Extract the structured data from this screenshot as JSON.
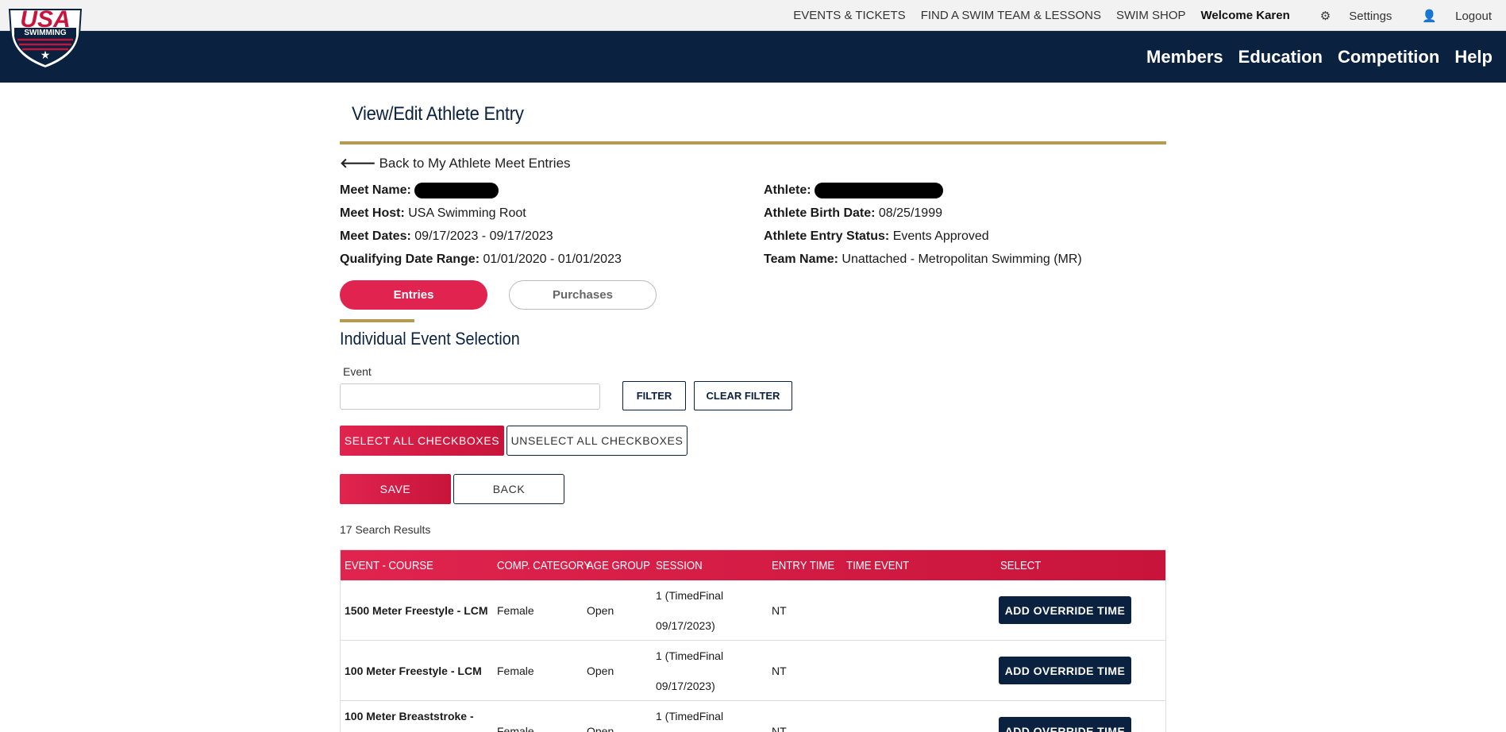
{
  "topbar": {
    "events_tickets": "EVENTS & TICKETS",
    "find_swim_team": "FIND A SWIM TEAM & LESSONS",
    "swim_shop": "SWIM SHOP",
    "welcome": "Welcome Karen",
    "settings": "Settings",
    "logout": "Logout"
  },
  "logo": {
    "line1": "USA",
    "line2": "SWIMMING"
  },
  "mainnav": {
    "members": "Members",
    "education": "Education",
    "competition": "Competition",
    "help": "Help"
  },
  "page": {
    "title": "View/Edit Athlete Entry",
    "back_link": "Back to My Athlete Meet Entries"
  },
  "meet_info": {
    "meet_name_label": "Meet Name:",
    "meet_host_label": "Meet Host:",
    "meet_host": "USA Swimming Root",
    "meet_dates_label": "Meet Dates:",
    "meet_dates": "09/17/2023 - 09/17/2023",
    "qualifying_label": "Qualifying Date Range:",
    "qualifying_range": "01/01/2020 - 01/01/2023"
  },
  "athlete_info": {
    "athlete_label": "Athlete:",
    "birth_label": "Athlete Birth Date:",
    "birth_date": "08/25/1999",
    "status_label": "Athlete Entry Status:",
    "status": "Events Approved",
    "team_label": "Team Name:",
    "team": "Unattached - Metropolitan Swimming (MR)"
  },
  "tabs": {
    "entries": "Entries",
    "purchases": "Purchases"
  },
  "section": {
    "title": "Individual Event Selection",
    "event_label": "Event",
    "event_value": "",
    "filter": "FILTER",
    "clear_filter": "CLEAR FILTER",
    "select_all": "SELECT ALL CHECKBOXES",
    "unselect_all": "UNSELECT ALL CHECKBOXES",
    "save": "SAVE",
    "back": "BACK",
    "results_count": "17 Search Results"
  },
  "table": {
    "headers": {
      "event_course": "EVENT - COURSE",
      "comp_category": "COMP. CATEGORY",
      "age_group": "AGE GROUP",
      "session": "SESSION",
      "entry_time": "ENTRY TIME",
      "time_event": "TIME EVENT",
      "select": "SELECT"
    },
    "rows": [
      {
        "event": "1500 Meter Freestyle - LCM",
        "category": "Female",
        "age_group": "Open",
        "session_line1": "1 (TimedFinal",
        "session_line2": "09/17/2023)",
        "entry_time": "NT",
        "action": "ADD OVERRIDE TIME"
      },
      {
        "event": "100 Meter Freestyle - LCM",
        "category": "Female",
        "age_group": "Open",
        "session_line1": "1 (TimedFinal",
        "session_line2": "09/17/2023)",
        "entry_time": "NT",
        "action": "ADD OVERRIDE TIME"
      },
      {
        "event": "100 Meter Breaststroke -",
        "category": "Female",
        "age_group": "Open",
        "session_line1": "1 (TimedFinal",
        "session_line2": "",
        "entry_time": "NT",
        "action": "ADD OVERRIDE TIME"
      }
    ]
  },
  "colors": {
    "navy": "#0a2240",
    "red": "#e0244f",
    "gold": "#b39b52"
  },
  "icons": {
    "back": "arrow-left-icon",
    "settings": "gear-icon",
    "logout": "user-icon"
  }
}
